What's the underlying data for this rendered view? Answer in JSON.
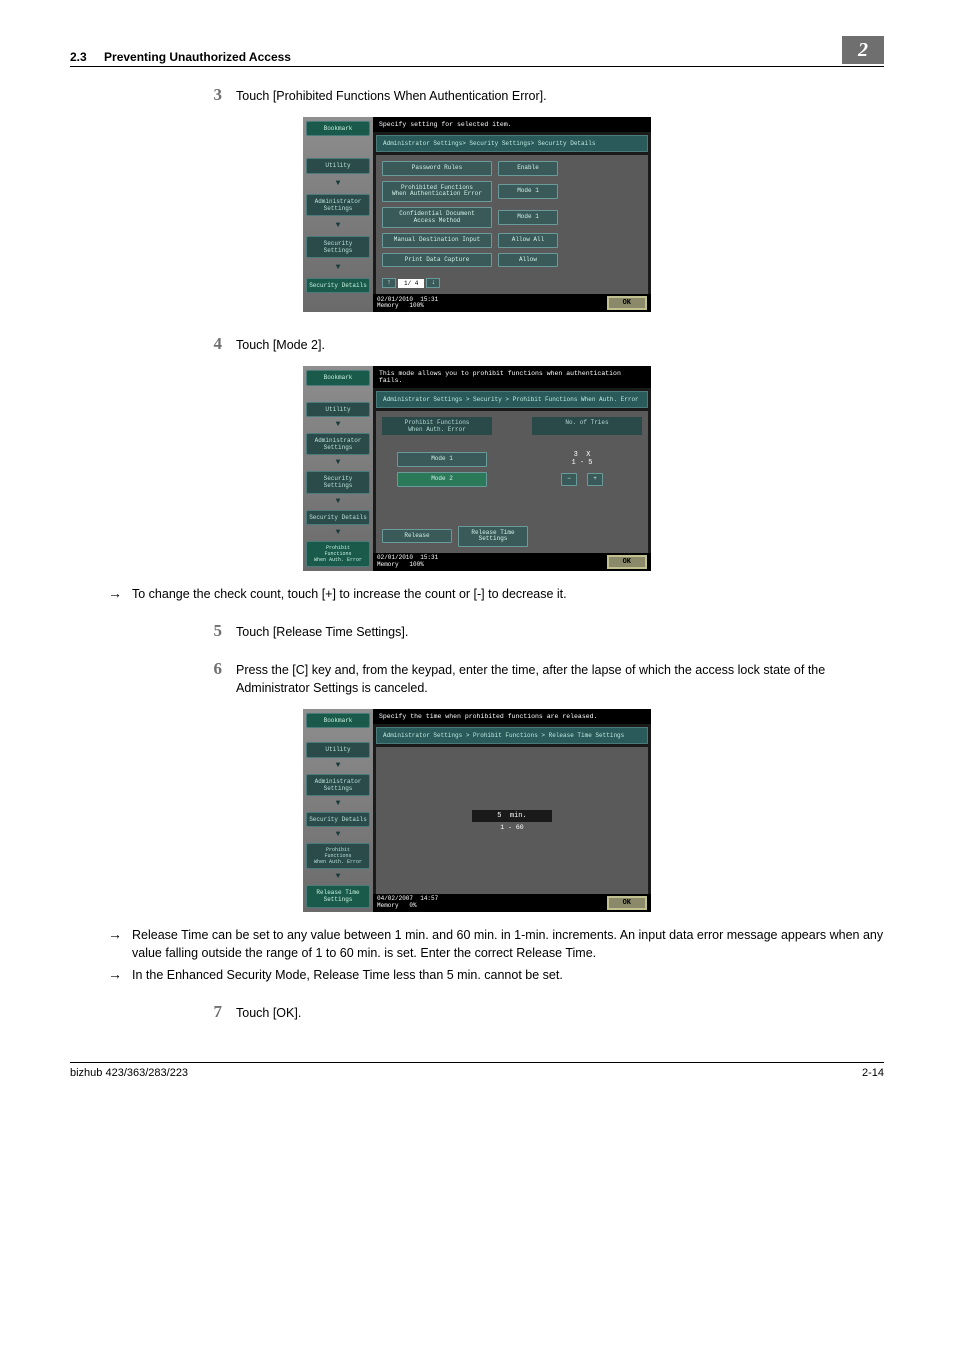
{
  "header": {
    "section_num": "2.3",
    "section_title": "Preventing Unauthorized Access",
    "chapter": "2"
  },
  "steps": {
    "s3": {
      "num": "3",
      "text": "Touch [Prohibited Functions When Authentication Error]."
    },
    "s4": {
      "num": "4",
      "text": "Touch [Mode 2]."
    },
    "s4_bullet": "To change the check count, touch [+] to increase the count or [-] to decrease it.",
    "s5": {
      "num": "5",
      "text": "Touch [Release Time Settings]."
    },
    "s6": {
      "num": "6",
      "text": "Press the [C] key and, from the keypad, enter the time, after the lapse of which the access lock state of the Administrator Settings is canceled."
    },
    "s6_b1": "Release Time can be set to any value between 1 min. and 60 min. in 1-min. increments. An input data error message appears when any value falling outside the range of 1 to 60 min. is set. Enter the correct Release Time.",
    "s6_b2": "In the Enhanced Security Mode, Release Time less than 5 min. cannot be set.",
    "s7": {
      "num": "7",
      "text": "Touch [OK]."
    }
  },
  "ss1": {
    "top": "Specify setting for selected item.",
    "bread": "Administrator Settings> Security Settings> Security Details",
    "side": {
      "bookmark": "Bookmark",
      "utility": "Utility",
      "admin": "Administrator\nSettings",
      "sec": "Security\nSettings",
      "detail": "Security Details"
    },
    "rows": {
      "r1a": "Password Rules",
      "r1b": "Enable",
      "r2a": "Prohibited Functions\nWhen Authentication Error",
      "r2b": "Mode 1",
      "r3a": "Confidential Document\nAccess Method",
      "r3b": "Mode 1",
      "r4a": "Manual Destination Input",
      "r4b": "Allow All",
      "r5a": "Print Data Capture",
      "r5b": "Allow"
    },
    "pager": "1/ 4",
    "date": "02/01/2010",
    "time": "15:31",
    "mem": "Memory",
    "memv": "100%",
    "ok": "OK"
  },
  "ss2": {
    "top": "This mode allows you to prohibit functions when authentication fails.",
    "bread": "Administrator Settings > Security > Prohibit Functions When Auth. Error",
    "side": {
      "bookmark": "Bookmark",
      "utility": "Utility",
      "admin": "Administrator\nSettings",
      "sec": "Security\nSettings",
      "detail": "Security Details",
      "prohibit": "Prohibit\nFunctions\nWhen Auth. Error"
    },
    "hdr1": "Prohibit Functions\nWhen Auth. Error",
    "hdr2": "No. of Tries",
    "mode1": "Mode 1",
    "mode2": "Mode 2",
    "tries_val": "3",
    "tries_x": "X",
    "tries_range": "1 - 5",
    "minus": "−",
    "plus": "+",
    "release": "Release",
    "reltime": "Release Time\nSettings",
    "date": "02/01/2010",
    "time": "15:31",
    "mem": "Memory",
    "memv": "100%",
    "ok": "OK"
  },
  "ss3": {
    "top": "Specify the time when prohibited functions are released.",
    "bread": "Administrator Settings > Prohibit Functions > Release Time Settings",
    "side": {
      "bookmark": "Bookmark",
      "utility": "Utility",
      "admin": "Administrator\nSettings",
      "detail": "Security Details",
      "prohibit": "Prohibit\nFunctions\nWhen Auth. Error",
      "rel": "Release Time\nSettings"
    },
    "val": "5",
    "unit": "min.",
    "range": "1 - 60",
    "date": "04/02/2007",
    "time": "14:57",
    "mem": "Memory",
    "memv": "0%",
    "ok": "OK"
  },
  "footer": {
    "left": "bizhub 423/363/283/223",
    "right": "2-14"
  }
}
